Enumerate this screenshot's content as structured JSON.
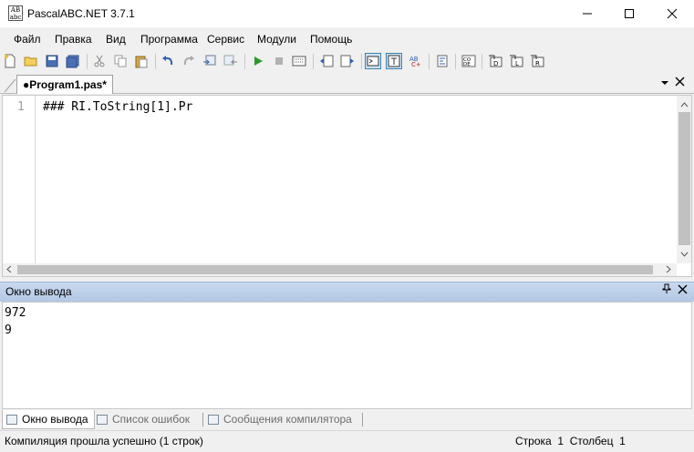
{
  "window": {
    "title": "PascalABC.NET 3.7.1",
    "icon_text": "AB\nabc"
  },
  "menu": [
    "Файл",
    "Правка",
    "Вид",
    "Программа",
    "Сервис",
    "Модули",
    "Помощь"
  ],
  "tab": {
    "label": "●Program1.pas*"
  },
  "editor": {
    "line_number": "1",
    "code": "### RI.ToString[1].Pr"
  },
  "output": {
    "title": "Окно вывода",
    "lines": [
      "972",
      "9"
    ]
  },
  "bottom_tabs": [
    "Окно вывода",
    "Список ошибок",
    "Сообщения компилятора"
  ],
  "status": {
    "message": "Компиляция прошла успешно (1 строк)",
    "row_label": "Строка",
    "row_value": "1",
    "col_label": "Столбец",
    "col_value": "1"
  },
  "colors": {
    "accent": "#3c7fb1",
    "output_header": "#b2c8e4",
    "run_green": "#2e9a2e"
  },
  "toolbar_icons": [
    "new-file-icon",
    "open-icon",
    "save-icon",
    "save-all-icon",
    "cut-icon",
    "copy-icon",
    "paste-icon",
    "undo-icon",
    "redo-icon",
    "indent-icon",
    "outdent-icon",
    "run-icon",
    "stop-icon",
    "debug-icon",
    "comment-icon",
    "uncomment-icon",
    "console-icon",
    "text-icon",
    "abc-icon",
    "format-icon",
    "code-icon",
    "step-into-icon",
    "step-over-icon",
    "run-to-cursor-icon"
  ]
}
